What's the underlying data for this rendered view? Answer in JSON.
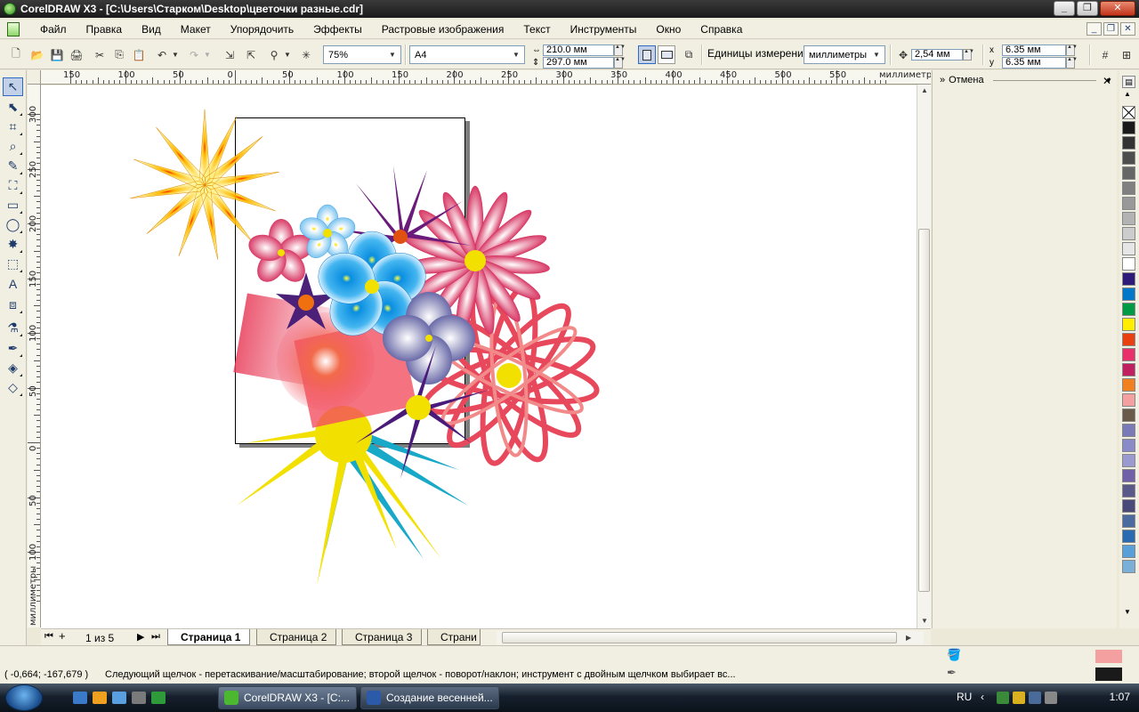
{
  "window": {
    "title": "CorelDRAW X3 - [C:\\Users\\Старком\\Desktop\\цветочки разные.cdr]"
  },
  "menu": [
    "Файл",
    "Правка",
    "Вид",
    "Макет",
    "Упорядочить",
    "Эффекты",
    "Растровые изображения",
    "Текст",
    "Инструменты",
    "Окно",
    "Справка"
  ],
  "toolbar": {
    "zoom": "75%",
    "paper_size": "A4",
    "page_width": "210.0 мм",
    "page_height": "297.0 мм",
    "units_label": "Единицы измерения:",
    "units_value": "миллиметры",
    "nudge": "2,54 мм",
    "dup_x": "6.35 мм",
    "dup_y": "6.35 мм",
    "dup_x_label": "x",
    "dup_y_label": "y"
  },
  "ruler": {
    "h_numbers": [
      "150",
      "100",
      "50",
      "0",
      "50",
      "100",
      "150",
      "200",
      "250",
      "300",
      "350",
      "400",
      "450",
      "500",
      "550"
    ],
    "h_unit": "миллиметры",
    "v_numbers": [
      "300",
      "250",
      "200",
      "150",
      "100",
      "50",
      "0",
      "50",
      "100"
    ],
    "v_unit": "миллиметры"
  },
  "docker": {
    "title": "Отмена"
  },
  "palette": [
    "#1a1a1a",
    "#333333",
    "#4d4d4d",
    "#666666",
    "#808080",
    "#999999",
    "#b3b3b3",
    "#cccccc",
    "#e6e6e6",
    "#ffffff",
    "#2e1a78",
    "#0077c8",
    "#009944",
    "#ffee00",
    "#e84010",
    "#e8306a",
    "#c02060",
    "#f08020",
    "#f4a0a0",
    "#6a5a4a",
    "#7a7ab8",
    "#8a8ac8",
    "#9a9ad0",
    "#7060a8",
    "#5a5a8a",
    "#4a4a7a",
    "#4a6aa0",
    "#2a6ab0",
    "#5aa0d8",
    "#7ab0d8"
  ],
  "pages": {
    "counter": "1 из 5",
    "tabs": [
      "Страница 1",
      "Страница 2",
      "Страница 3",
      "Страни"
    ]
  },
  "status": {
    "coords": "( -0,664; -167,679 )",
    "hint": "Следующий щелчок - перетаскивание/масштабирование; второй щелчок - поворот/наклон; инструмент с двойным щелчком выбирает вс...",
    "fill_color": "#f4a0a0",
    "outline_color": "#1a1a1a"
  },
  "taskbar": {
    "tasks": [
      "CorelDRAW X3 - [C:...",
      "Создание весенней..."
    ],
    "lang": "RU",
    "clock": "1:07"
  }
}
